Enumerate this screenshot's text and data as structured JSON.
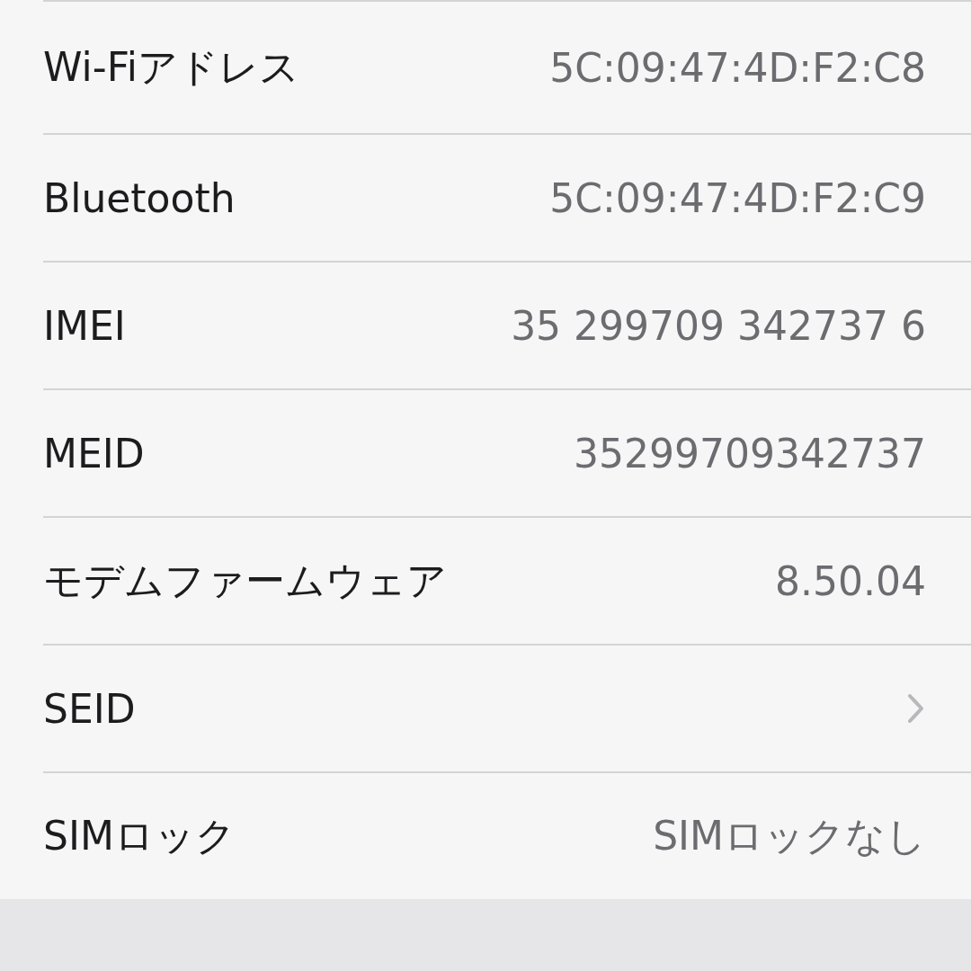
{
  "rows": [
    {
      "kind": "value",
      "label": "Wi-Fiアドレス",
      "value": "5C:09:47:4D:F2:C8"
    },
    {
      "kind": "value",
      "label": "Bluetooth",
      "value": "5C:09:47:4D:F2:C9"
    },
    {
      "kind": "value",
      "label": "IMEI",
      "value": "35 299709 342737 6"
    },
    {
      "kind": "value",
      "label": "MEID",
      "value": "35299709342737"
    },
    {
      "kind": "value",
      "label": "モデムファームウェア",
      "value": "8.50.04"
    },
    {
      "kind": "link",
      "label": "SEID"
    },
    {
      "kind": "value",
      "label": "SIMロック",
      "value": "SIMロックなし"
    }
  ]
}
